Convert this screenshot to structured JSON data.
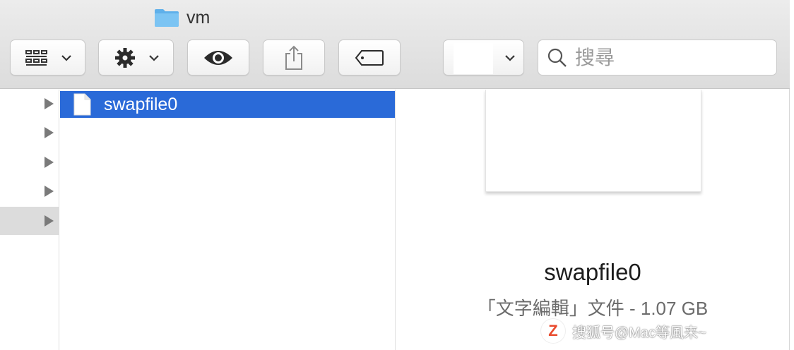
{
  "window": {
    "title": "vm"
  },
  "toolbar": {
    "view_icon": "grid-view-icon",
    "action_icon": "gear-icon",
    "quicklook_icon": "eye-icon",
    "share_icon": "share-icon",
    "tags_icon": "tag-icon",
    "group_icon": "chevron-down-icon"
  },
  "search": {
    "placeholder": "搜尋"
  },
  "columns": {
    "left_rows": 5,
    "selected_file": "swapfile0"
  },
  "preview": {
    "name": "swapfile0",
    "info": "「文字編輯」文件 - 1.07 GB"
  },
  "watermark": {
    "logo": "Z",
    "text": "搜狐号@Mac等風来~"
  },
  "colors": {
    "selection": "#2a6ad8",
    "folder": "#6ab7ec"
  }
}
